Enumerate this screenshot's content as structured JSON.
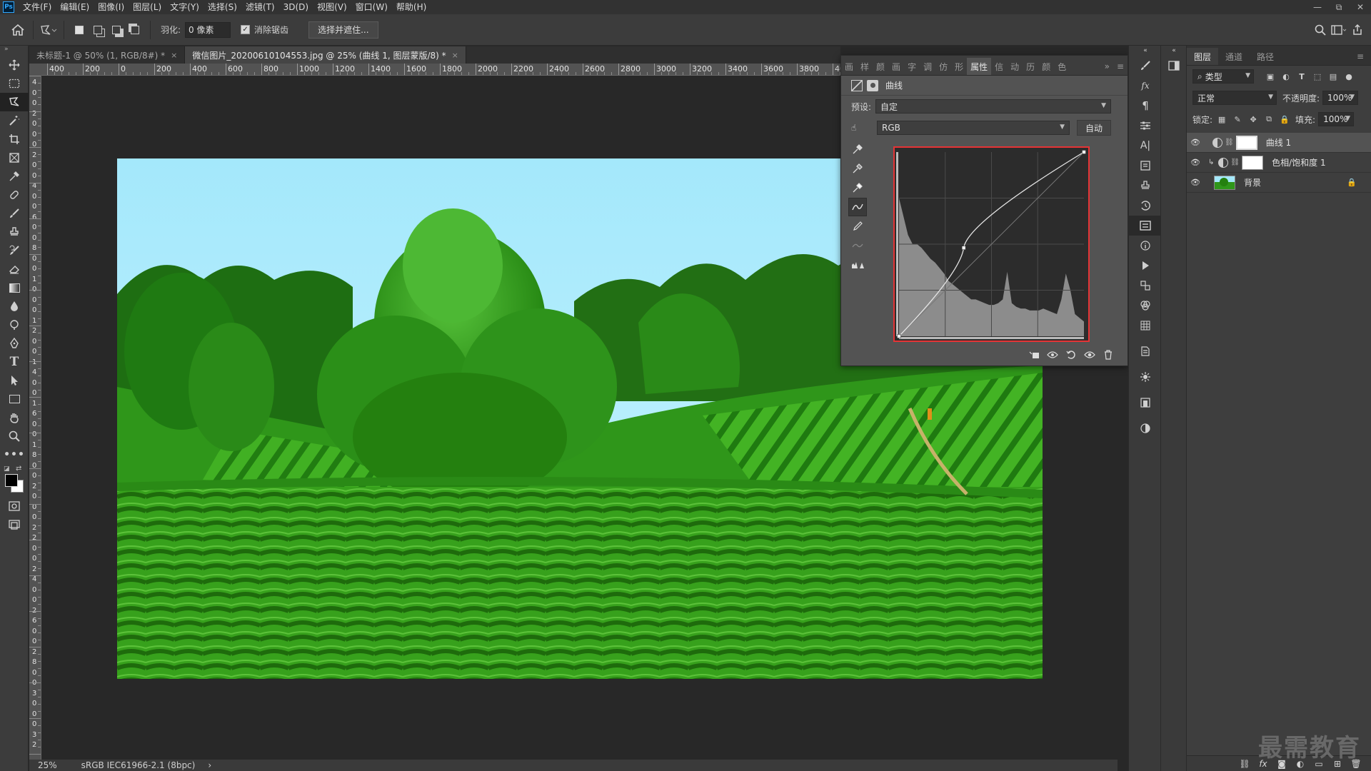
{
  "app": {
    "logo": "Ps",
    "win_controls": [
      "—",
      "⧉",
      "✕"
    ]
  },
  "menu": [
    "文件(F)",
    "编辑(E)",
    "图像(I)",
    "图层(L)",
    "文字(Y)",
    "选择(S)",
    "滤镜(T)",
    "3D(D)",
    "视图(V)",
    "窗口(W)",
    "帮助(H)"
  ],
  "options": {
    "feather_label": "羽化:",
    "feather_value": "0 像素",
    "antialias_label": "消除锯齿",
    "antialias_checked": true,
    "select_mask_label": "选择并遮住..."
  },
  "tabs": [
    {
      "label": "未标题-1 @ 50% (1, RGB/8#) *",
      "active": false
    },
    {
      "label": "微信图片_20200610104553.jpg @ 25% (曲线 1, 图层蒙版/8) *",
      "active": true
    }
  ],
  "ruler_h": [
    "400",
    "200",
    "0",
    "200",
    "400",
    "600",
    "800",
    "1000",
    "1200",
    "1400",
    "1600",
    "1800",
    "2000",
    "2200",
    "2400",
    "2600",
    "2800",
    "3000",
    "3200",
    "3400",
    "3600",
    "3800",
    "40"
  ],
  "ruler_v": [
    "4",
    "0",
    "0",
    "2",
    "0",
    "0",
    "0",
    "2",
    "0",
    "0",
    "4",
    "0",
    "0",
    "6",
    "0",
    "0",
    "8",
    "0",
    "0",
    "1",
    "0",
    "0",
    "0",
    "1",
    "2",
    "0",
    "0",
    "1",
    "4",
    "0",
    "0",
    "1",
    "6",
    "0",
    "0",
    "1",
    "8",
    "0",
    "0",
    "2",
    "0",
    "0",
    "0",
    "2",
    "2",
    "0",
    "0",
    "2",
    "4",
    "0",
    "0",
    "2",
    "6",
    "0",
    "0",
    "2",
    "8",
    "0",
    "0",
    "3",
    "0",
    "0",
    "0",
    "3",
    "2"
  ],
  "status": {
    "zoom": "25%",
    "profile": "sRGB IEC61966-2.1 (8bpc)",
    "arrow": "›"
  },
  "properties": {
    "tabs": [
      "画",
      "样",
      "颜",
      "画",
      "字",
      "调",
      "仿",
      "形",
      "属性",
      "信",
      "动",
      "历",
      "颜",
      "色"
    ],
    "active_tab": "属性",
    "title": "曲线",
    "preset_label": "预设:",
    "preset_value": "自定",
    "channel_value": "RGB",
    "auto_label": "自动",
    "curve_points": [
      [
        0,
        0
      ],
      [
        0.35,
        0.48
      ],
      [
        1,
        1
      ]
    ]
  },
  "layers": {
    "tabs": [
      "图层",
      "通道",
      "路径"
    ],
    "filter_value": "类型",
    "blend_mode": "正常",
    "opacity_label": "不透明度:",
    "opacity_value": "100%",
    "lock_label": "锁定:",
    "fill_label": "填充:",
    "fill_value": "100%",
    "items": [
      {
        "name": "曲线 1",
        "selected": true,
        "clipped": false
      },
      {
        "name": "色相/饱和度 1",
        "selected": false,
        "clipped": true
      },
      {
        "name": "背景",
        "selected": false,
        "locked": true
      }
    ]
  },
  "watermark": "最需教育",
  "colors": {
    "accent_red": "#e53335",
    "panel": "#535353",
    "canvas": "#282828"
  }
}
